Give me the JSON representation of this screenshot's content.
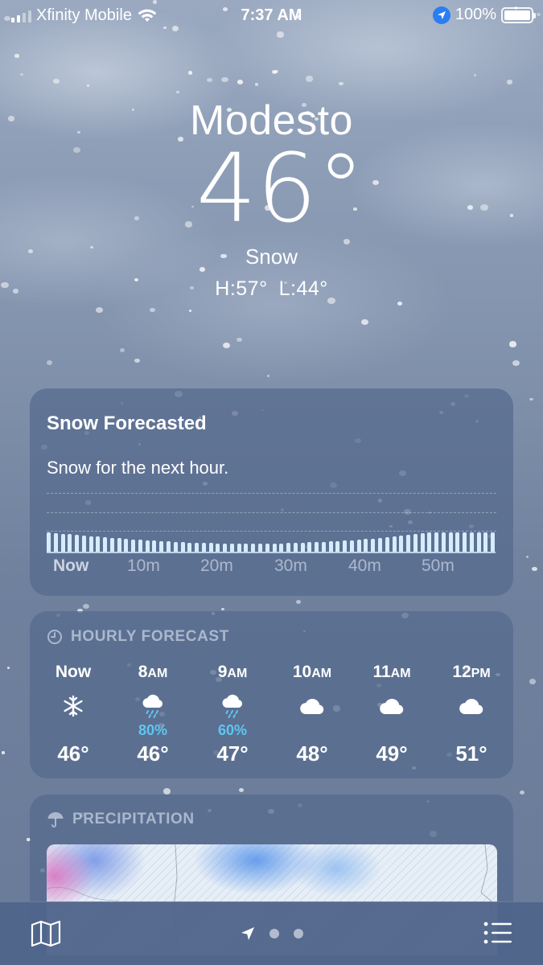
{
  "status_bar": {
    "carrier": "Xfinity Mobile",
    "time": "7:37 AM",
    "battery": "100%",
    "icons": [
      "signal-icon",
      "wifi-icon",
      "location-arrow-icon",
      "battery-icon"
    ]
  },
  "hero": {
    "city": "Modesto",
    "temperature": "46°",
    "condition": "Snow",
    "high": "H:57°",
    "low": "L:44°"
  },
  "nowcast": {
    "title": "Snow Forecasted",
    "description": "Snow for the next hour.",
    "ticks": [
      "Now",
      "10m",
      "20m",
      "30m",
      "40m",
      "50m"
    ],
    "bar_color": "#d6ecff"
  },
  "hourly": {
    "header": "HOURLY FORECAST",
    "header_icon": "clock-icon",
    "hours": [
      {
        "time": "Now",
        "suffix": "",
        "icon": "snowflake-icon",
        "precip": "",
        "temp": "46°"
      },
      {
        "time": "8",
        "suffix": "AM",
        "icon": "cloud-rain-icon",
        "precip": "80%",
        "temp": "46°"
      },
      {
        "time": "9",
        "suffix": "AM",
        "icon": "cloud-rain-icon",
        "precip": "60%",
        "temp": "47°"
      },
      {
        "time": "10",
        "suffix": "AM",
        "icon": "cloud-icon",
        "precip": "",
        "temp": "48°"
      },
      {
        "time": "11",
        "suffix": "AM",
        "icon": "cloud-icon",
        "precip": "",
        "temp": "49°"
      },
      {
        "time": "12",
        "suffix": "PM",
        "icon": "cloud-icon",
        "precip": "",
        "temp": "51°"
      }
    ],
    "precip_color": "#5fc6f2"
  },
  "precipitation": {
    "header": "PRECIPITATION",
    "header_icon": "umbrella-icon"
  },
  "toolbar": {
    "icons": [
      "map-icon",
      "location-arrow-icon",
      "page-dot-icon",
      "page-dot-icon",
      "list-icon"
    ]
  },
  "colors": {
    "card": "#54698e",
    "sky": "#8d9db6",
    "location_badge": "#2a7ef0"
  }
}
